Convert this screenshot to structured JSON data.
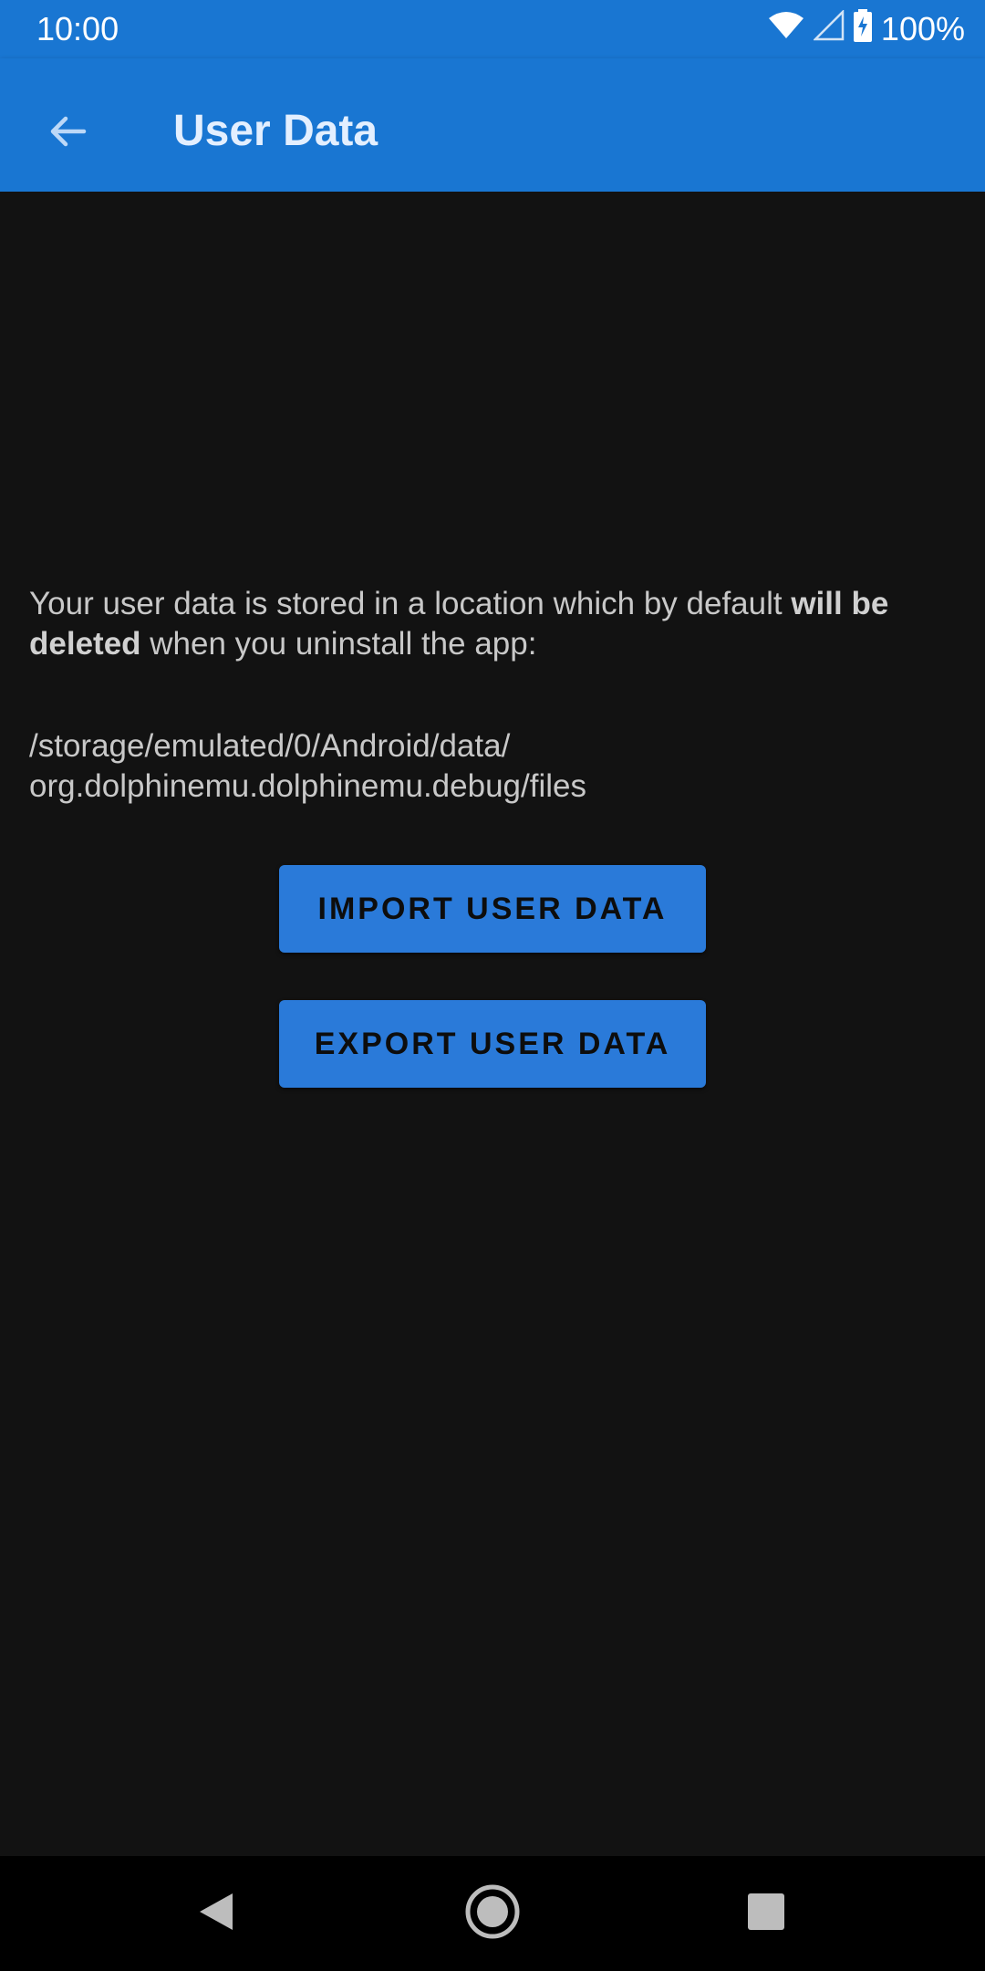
{
  "status_bar": {
    "time": "10:00",
    "battery": "100%",
    "icons": [
      "wifi-icon",
      "cell-signal-icon",
      "battery-charging-icon"
    ]
  },
  "app_bar": {
    "title": "User Data",
    "back_icon": "arrow-back-icon",
    "color": "#1976d2"
  },
  "content": {
    "info_prefix": "Your user data is stored in a location which by default ",
    "info_bold": "will be deleted",
    "info_suffix": " when you uninstall the app:",
    "path_line1": "/storage/emulated/0/Android/data/",
    "path_line2": "org.dolphinemu.dolphinemu.debug/files",
    "import_label": "IMPORT USER DATA",
    "export_label": "EXPORT USER DATA",
    "button_color": "#2a7ad9"
  },
  "nav_bar": {
    "icons": [
      "nav-back-icon",
      "nav-home-icon",
      "nav-recents-icon"
    ]
  }
}
